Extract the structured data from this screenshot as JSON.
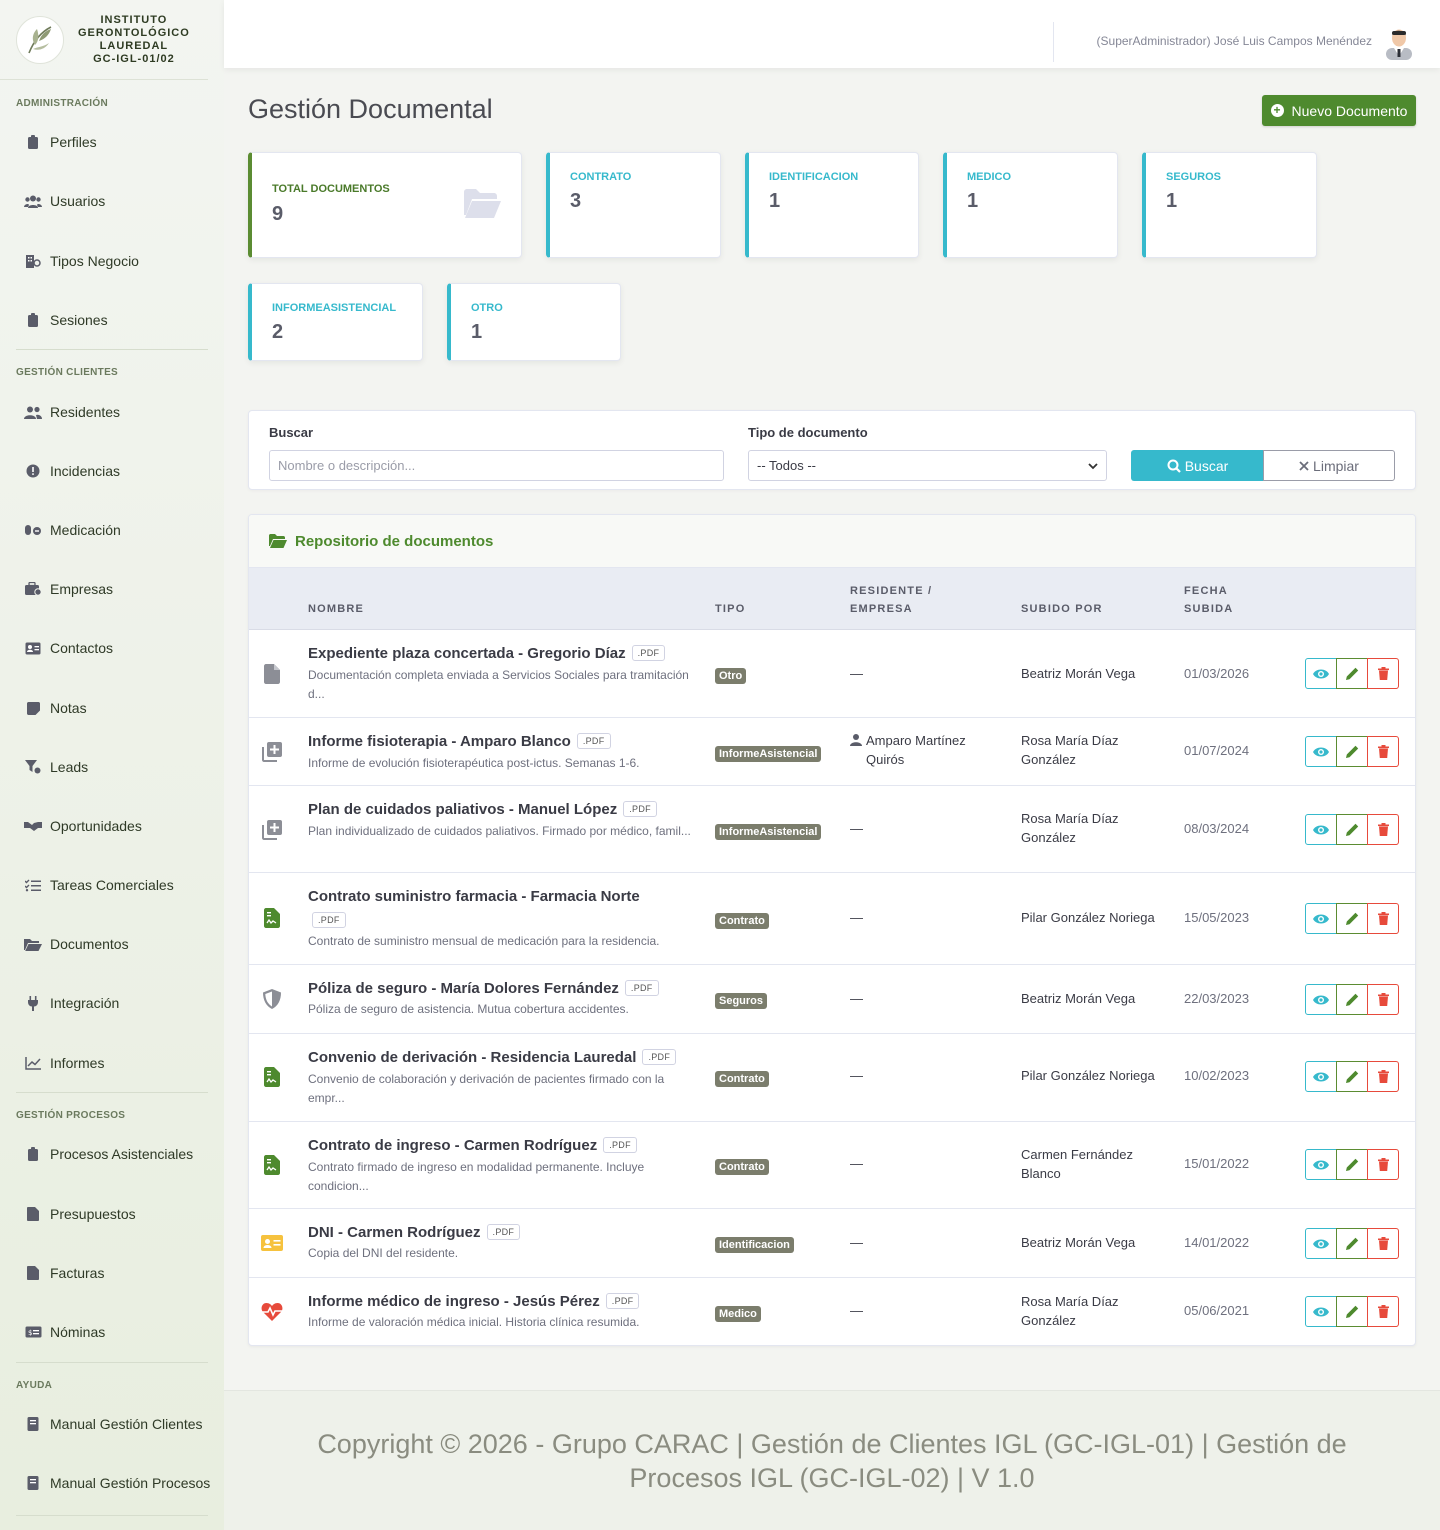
{
  "brand": {
    "line1": "INSTITUTO",
    "line2": "GERONTOLÓGICO",
    "line3": "LAUREDAL",
    "line4": "GC-IGL-01/02"
  },
  "sidebar": {
    "sections": [
      {
        "heading": "ADMINISTRACIÓN",
        "items": [
          "Perfiles",
          "Usuarios",
          "Tipos Negocio",
          "Sesiones"
        ]
      },
      {
        "heading": "GESTIÓN CLIENTES",
        "items": [
          "Residentes",
          "Incidencias",
          "Medicación",
          "Empresas",
          "Contactos",
          "Notas",
          "Leads",
          "Oportunidades",
          "Tareas Comerciales",
          "Documentos",
          "Integración",
          "Informes"
        ]
      },
      {
        "heading": "GESTIÓN PROCESOS",
        "items": [
          "Procesos Asistenciales",
          "Presupuestos",
          "Facturas",
          "Nóminas"
        ]
      },
      {
        "heading": "AYUDA",
        "items": [
          "Manual Gestión Clientes",
          "Manual Gestión Procesos"
        ]
      }
    ]
  },
  "topbar": {
    "user": "(SuperAdministrador) José Luis Campos Menéndez"
  },
  "page": {
    "title": "Gestión Documental",
    "new_button": "Nuevo Documento"
  },
  "stats": [
    {
      "label": "TOTAL DOCUMENTOS",
      "value": "9"
    },
    {
      "label": "CONTRATO",
      "value": "3"
    },
    {
      "label": "IDENTIFICACION",
      "value": "1"
    },
    {
      "label": "MEDICO",
      "value": "1"
    },
    {
      "label": "SEGUROS",
      "value": "1"
    },
    {
      "label": "INFORMEASISTENCIAL",
      "value": "2"
    },
    {
      "label": "OTRO",
      "value": "1"
    }
  ],
  "filter": {
    "search_label": "Buscar",
    "search_placeholder": "Nombre o descripción...",
    "type_label": "Tipo de documento",
    "type_value": "-- Todos --",
    "search_button": "Buscar",
    "clear_button": "Limpiar"
  },
  "table": {
    "title": "Repositorio de documentos",
    "headers": {
      "name": "NOMBRE",
      "type": "TIPO",
      "resident_1": "RESIDENTE /",
      "resident_2": "EMPRESA",
      "by": "SUBIDO POR",
      "date_1": "FECHA",
      "date_2": "SUBIDA"
    },
    "rows": [
      {
        "name": "Expediente plaza concertada - Gregorio Díaz",
        "ext": ".PDF",
        "desc": "Documentación completa enviada a Servicios Sociales para tramitación d...",
        "type": "Otro",
        "resident": "—",
        "by": "Beatriz Morán Vega",
        "date": "01/03/2026"
      },
      {
        "name": "Informe fisioterapia - Amparo Blanco",
        "ext": ".PDF",
        "desc": "Informe de evolución fisioterapéutica post-ictus. Semanas 1-6.",
        "type": "InformeAsistencial",
        "resident": "Amparo Martínez Quirós",
        "by": "Rosa María Díaz González",
        "date": "01/07/2024"
      },
      {
        "name": "Plan de cuidados paliativos - Manuel López",
        "ext": ".PDF",
        "desc": "Plan individualizado de cuidados paliativos. Firmado por médico, famil...",
        "type": "InformeAsistencial",
        "resident": "—",
        "by": "Rosa María Díaz González",
        "date": "08/03/2024"
      },
      {
        "name": "Contrato suministro farmacia - Farmacia Norte",
        "ext": ".PDF",
        "desc": "Contrato de suministro mensual de medicación para la residencia.",
        "type": "Contrato",
        "resident": "—",
        "by": "Pilar González Noriega",
        "date": "15/05/2023"
      },
      {
        "name": "Póliza de seguro - María Dolores Fernández",
        "ext": ".PDF",
        "desc": "Póliza de seguro de asistencia. Mutua cobertura accidentes.",
        "type": "Seguros",
        "resident": "—",
        "by": "Beatriz Morán Vega",
        "date": "22/03/2023"
      },
      {
        "name": "Convenio de derivación - Residencia Lauredal",
        "ext": ".PDF",
        "desc": "Convenio de colaboración y derivación de pacientes firmado con la empr...",
        "type": "Contrato",
        "resident": "—",
        "by": "Pilar González Noriega",
        "date": "10/02/2023"
      },
      {
        "name": "Contrato de ingreso - Carmen Rodríguez",
        "ext": ".PDF",
        "desc": "Contrato firmado de ingreso en modalidad permanente. Incluye condicion...",
        "type": "Contrato",
        "resident": "—",
        "by": "Carmen Fernández Blanco",
        "date": "15/01/2022"
      },
      {
        "name": "DNI - Carmen Rodríguez",
        "ext": ".PDF",
        "desc": "Copia del DNI del residente.",
        "type": "Identificacion",
        "resident": "—",
        "by": "Beatriz Morán Vega",
        "date": "14/01/2022"
      },
      {
        "name": "Informe médico de ingreso - Jesús Pérez",
        "ext": ".PDF",
        "desc": "Informe de valoración médica inicial. Historia clínica resumida.",
        "type": "Medico",
        "resident": "—",
        "by": "Rosa María Díaz González",
        "date": "05/06/2021"
      }
    ]
  },
  "footer": {
    "text": "Copyright © 2026 - Grupo CARAC | Gestión de Clientes IGL (GC-IGL-01) | Gestión de Procesos IGL (GC-IGL-02) | V 1.0"
  },
  "colors": {
    "primary": "#4e8a2e",
    "info": "#36b9cc",
    "danger": "#e74a3b",
    "badge": "#7b7d6c"
  }
}
